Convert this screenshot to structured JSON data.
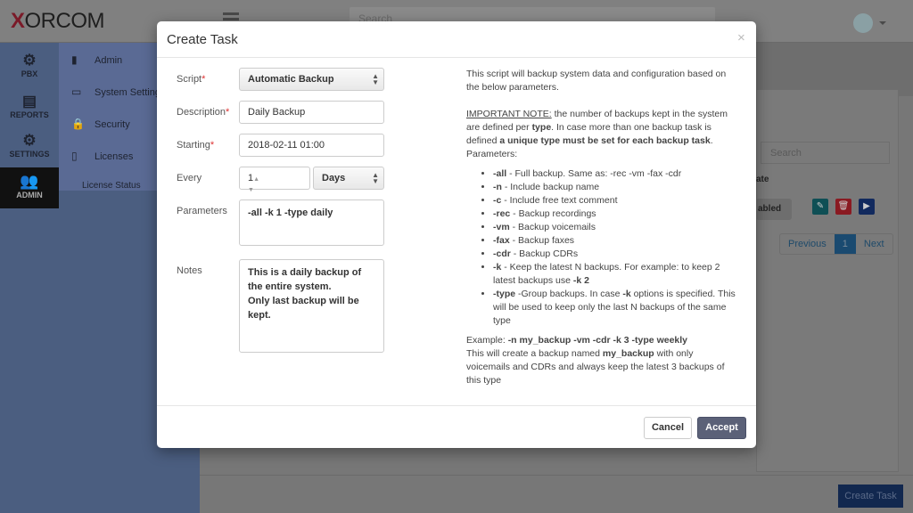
{
  "header": {
    "logo": "XORCOM",
    "search_placeholder": "Search"
  },
  "nav": [
    {
      "label": "PBX",
      "icon": "gear-icon"
    },
    {
      "label": "REPORTS",
      "icon": "document-icon"
    },
    {
      "label": "SETTINGS",
      "icon": "gears-icon"
    },
    {
      "label": "ADMIN",
      "icon": "users-icon",
      "active": true
    }
  ],
  "submenu": [
    {
      "label": "Admin",
      "icon": "building-icon"
    },
    {
      "label": "System Settings",
      "icon": "laptop-icon"
    },
    {
      "label": "Security",
      "icon": "lock-icon"
    },
    {
      "label": "Licenses",
      "icon": "certificate-icon"
    },
    {
      "label": "License Status"
    }
  ],
  "background": {
    "search_placeholder": "Search",
    "column_state": "ate",
    "state_value": "abled",
    "pager": {
      "previous": "Previous",
      "current": "1",
      "next": "Next"
    },
    "create_task": "Create Task"
  },
  "modal": {
    "title": "Create Task",
    "close": "×",
    "fields": {
      "script": {
        "label": "Script",
        "value": "Automatic Backup"
      },
      "description": {
        "label": "Description",
        "value": "Daily Backup"
      },
      "starting": {
        "label": "Starting",
        "value": "2018-02-11 01:00"
      },
      "every": {
        "label": "Every",
        "value": "1",
        "unit": "Days"
      },
      "parameters": {
        "label": "Parameters",
        "value": "-all -k 1 -type daily"
      },
      "notes": {
        "label": "Notes",
        "value": "This is a daily backup of the entire system.\nOnly last backup will be kept."
      }
    },
    "help": {
      "intro": "This script will backup system data and configuration based on the below parameters.",
      "note_label": "IMPORTANT NOTE:",
      "note_1": " the number of backups kept in the system are defined per ",
      "note_type": "type",
      "note_2": ". In case more than one backup task is defined ",
      "note_bold": "a unique type must be set for each backup task",
      "note_3": ". Parameters:",
      "params": [
        {
          "flag": "-all",
          "desc": " - Full backup. Same as: -rec -vm -fax -cdr"
        },
        {
          "flag": "-n",
          "desc": " - Include backup name"
        },
        {
          "flag": "-c",
          "desc": " - Include free text comment"
        },
        {
          "flag": "-rec",
          "desc": " - Backup recordings"
        },
        {
          "flag": "-vm",
          "desc": " - Backup voicemails"
        },
        {
          "flag": "-fax",
          "desc": " - Backup faxes"
        },
        {
          "flag": "-cdr",
          "desc": " - Backup CDRs"
        },
        {
          "flag": "-k",
          "desc": " - Keep the latest N backups. For example: to keep 2 latest backups use ",
          "extra": "-k 2"
        },
        {
          "flag": "-type",
          "desc": " -Group backups. In case ",
          "extra": "-k",
          "desc2": " options is specified. This will be used to keep only the last N backups of the same type"
        }
      ],
      "example_label": "Example: ",
      "example": "-n my_backup -vm -cdr -k 3 -type weekly",
      "example_desc_1": "This will create a backup named ",
      "example_name": "my_backup",
      "example_desc_2": " with only voicemails and CDRs and always keep the latest 3 backups of this type"
    },
    "cancel": "Cancel",
    "accept": "Accept"
  }
}
